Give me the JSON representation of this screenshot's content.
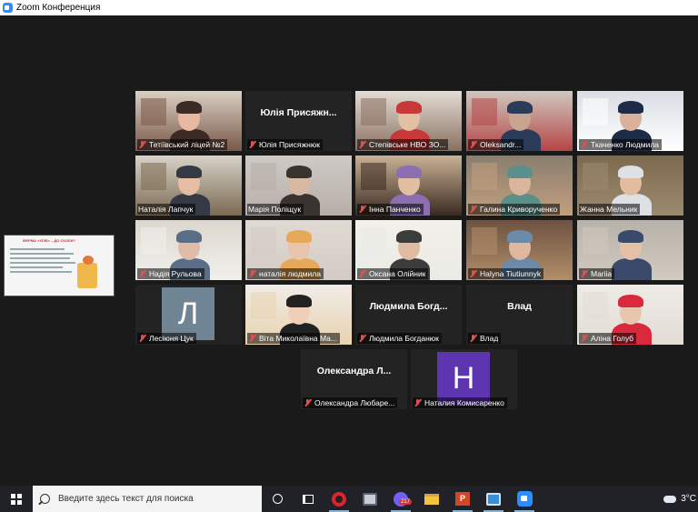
{
  "window": {
    "title": "Zoom Конференция"
  },
  "colors": {
    "active_speaker_border": "#c8d86a",
    "muted_mic": "#e05050",
    "zoom_blue": "#2d8cff"
  },
  "participants": [
    {
      "label": "Тетіївський ліцей №2",
      "muted": true,
      "mode": "video"
    },
    {
      "label": "Юлія Присяжнюк",
      "display": "Юлія Присяжн...",
      "muted": true,
      "mode": "name"
    },
    {
      "label": "Степівське НВО ЗО...",
      "muted": true,
      "mode": "video"
    },
    {
      "label": "Oleksandr...",
      "muted": true,
      "mode": "video"
    },
    {
      "label": "Ткаченко Людмила",
      "muted": true,
      "mode": "video"
    },
    {
      "label": "Наталія Лапчук",
      "muted": false,
      "mode": "video"
    },
    {
      "label": "Марія Поліщук",
      "muted": false,
      "mode": "video"
    },
    {
      "label": "Інна Панченко",
      "muted": true,
      "mode": "video"
    },
    {
      "label": "Галина Криворученко",
      "muted": true,
      "mode": "video"
    },
    {
      "label": "Жанна Мельник",
      "muted": false,
      "mode": "video",
      "active": true
    },
    {
      "label": "Надія Рульова",
      "muted": true,
      "mode": "video"
    },
    {
      "label": "наталія людмила",
      "muted": true,
      "mode": "video"
    },
    {
      "label": "Оксана Олійник",
      "muted": true,
      "mode": "video"
    },
    {
      "label": "Halyna Tiutiunnyk",
      "muted": true,
      "mode": "video"
    },
    {
      "label": "Mariia",
      "muted": true,
      "mode": "video"
    },
    {
      "label": "Лесіюня Цук",
      "muted": true,
      "mode": "avatar",
      "avatar_letter": "Л",
      "avatar_color": "#6f8593"
    },
    {
      "label": "Віта Миколаївна Ма...",
      "muted": true,
      "mode": "video"
    },
    {
      "label": "Людмила Богданюк",
      "display": "Людмила Богд...",
      "muted": true,
      "mode": "name"
    },
    {
      "label": "Влад",
      "display": "Влад",
      "muted": true,
      "mode": "name"
    },
    {
      "label": "Аліна Голуб",
      "muted": true,
      "mode": "video"
    },
    {
      "label": "Олександра Любаре...",
      "display": "Олександра Л...",
      "muted": true,
      "mode": "name"
    },
    {
      "label": "Наталия Комисаренко",
      "muted": true,
      "mode": "avatar",
      "avatar_letter": "Н",
      "avatar_color": "#5e35b1"
    }
  ],
  "shared_content": {
    "title": "ФЕРМА «ХЛІБ» – ДО СКОЛИ?"
  },
  "taskbar": {
    "search_placeholder": "Введите здесь текст для поиска",
    "viber_badge": "217",
    "temperature": "3°C",
    "icons": [
      "start-icon",
      "cortana-icon",
      "task-view-icon",
      "opera-icon",
      "generic-app-icon",
      "viber-icon",
      "explorer-icon",
      "powerpoint-icon",
      "generic-app2-icon",
      "zoom-icon"
    ]
  }
}
